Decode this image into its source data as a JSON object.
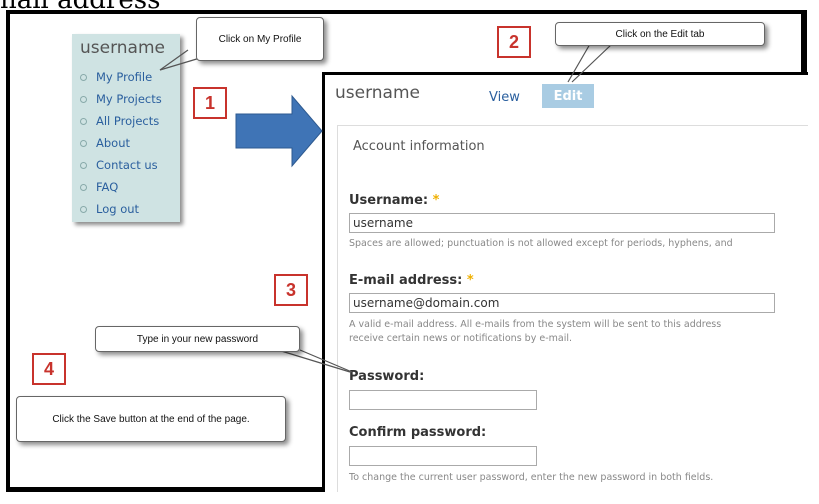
{
  "top_text": "nail address",
  "side_menu": {
    "title": "username",
    "items": [
      "My Profile",
      "My Projects",
      "All Projects",
      "About",
      "Contact us",
      "FAQ",
      "Log out"
    ]
  },
  "callouts": {
    "profile": "Click on My Profile",
    "edit_tab": "Click on the Edit tab",
    "password": "Type in your new password",
    "save": "Click the Save button at the end of the page."
  },
  "steps": [
    "1",
    "2",
    "3",
    "4"
  ],
  "profile": {
    "username_heading": "username",
    "tab_view": "View",
    "tab_edit": "Edit",
    "fieldset_legend": "Account information",
    "username_label": "Username:",
    "required_mark": "*",
    "username_value": "username",
    "username_help": "Spaces are allowed; punctuation is not allowed except for periods, hyphens, and",
    "email_label": "E-mail address:",
    "email_value": "username@domain.com",
    "email_help_1": "A valid e-mail address. All e-mails from the system will be sent to this address",
    "email_help_2": "receive certain news or notifications by e-mail.",
    "password_label": "Password:",
    "password_value": "",
    "confirm_label": "Confirm password:",
    "confirm_value": "",
    "password_help": "To change the current user password, enter the new password in both fields."
  },
  "colors": {
    "link": "#2a5f9e",
    "menu_bg": "#cfe3e3",
    "step_red": "#c8332c",
    "edit_tab_bg": "#a9cce3",
    "arrow_blue": "#3f74b6",
    "required": "#f0b000"
  }
}
